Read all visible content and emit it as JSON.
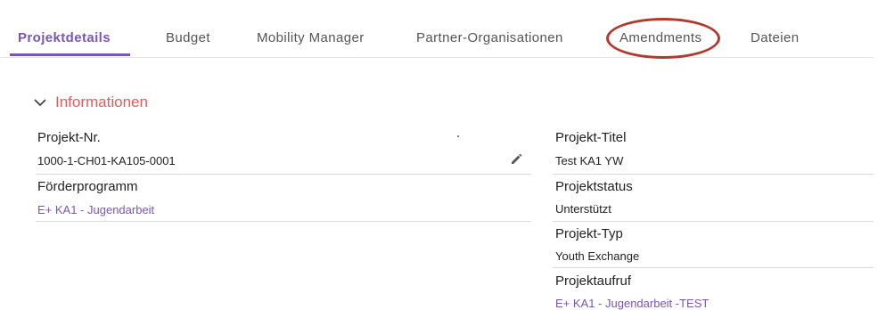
{
  "tabs": [
    {
      "label": "Projektdetails",
      "active": true
    },
    {
      "label": "Budget"
    },
    {
      "label": "Mobility Manager"
    },
    {
      "label": "Partner-Organisationen"
    },
    {
      "label": "Amendments"
    },
    {
      "label": "Dateien"
    }
  ],
  "section": {
    "title": "Informationen"
  },
  "left": {
    "project_nr": {
      "label": "Projekt-Nr.",
      "value": "1000-1-CH01-KA105-0001"
    },
    "program": {
      "label": "Förderprogramm",
      "value": "E+ KA1 - Jugendarbeit"
    }
  },
  "right": {
    "title": {
      "label": "Projekt-Titel",
      "value": "Test KA1 YW"
    },
    "status": {
      "label": "Projektstatus",
      "value": "Unterstützt"
    },
    "type": {
      "label": "Projekt-Typ",
      "value": "Youth Exchange"
    },
    "call": {
      "label": "Projektaufruf",
      "value": "E+ KA1 - Jugendarbeit -TEST"
    }
  },
  "colors": {
    "accent": "#7a55b8",
    "section_title": "#e45b5b",
    "highlight": "#b03a2e"
  },
  "icons": [
    "chevron-down-icon",
    "pencil-icon"
  ]
}
